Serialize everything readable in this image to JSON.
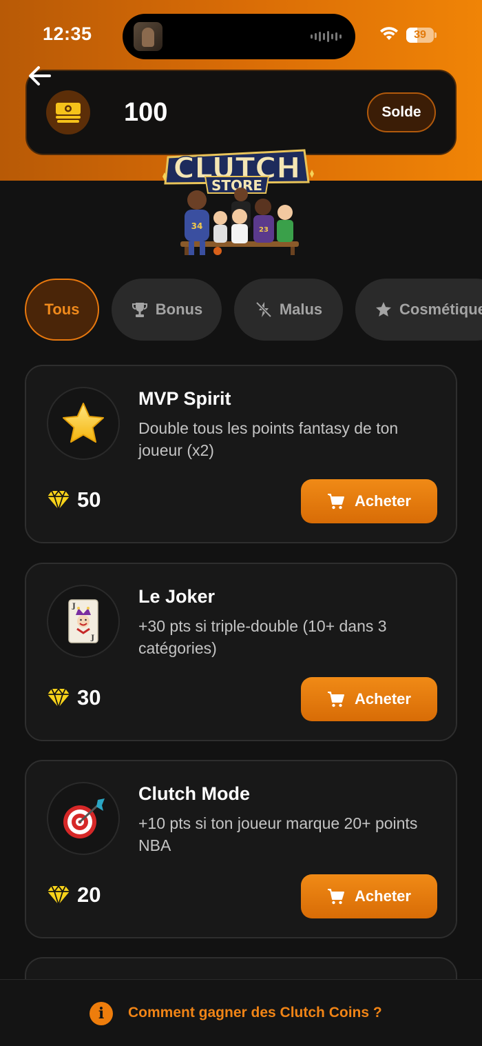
{
  "status_bar": {
    "time": "12:35",
    "battery": "39"
  },
  "balance": {
    "amount": "100",
    "solde_label": "Solde"
  },
  "logo": {
    "line1": "CLUTCH",
    "line2": "STORE"
  },
  "tabs": [
    {
      "label": "Tous",
      "icon": "none",
      "active": true
    },
    {
      "label": "Bonus",
      "icon": "trophy-icon"
    },
    {
      "label": "Malus",
      "icon": "lightning-off-icon"
    },
    {
      "label": "Cosmétique",
      "icon": "star-icon"
    }
  ],
  "items": [
    {
      "title": "MVP Spirit",
      "description": "Double tous les points fantasy de ton joueur (x2)",
      "price": "50",
      "buy_label": "Acheter",
      "icon": "star-emoji-icon"
    },
    {
      "title": "Le Joker",
      "description": "+30 pts si triple-double (10+ dans 3 catégories)",
      "price": "30",
      "buy_label": "Acheter",
      "icon": "joker-card-icon"
    },
    {
      "title": "Clutch Mode",
      "description": "+10 pts si ton joueur marque 20+ points NBA",
      "price": "20",
      "buy_label": "Acheter",
      "icon": "target-dart-icon"
    }
  ],
  "footer": {
    "link": "Comment gagner des Clutch Coins ?"
  },
  "colors": {
    "accent": "#f08416",
    "gem": "#f7d21a",
    "background": "#121212"
  }
}
